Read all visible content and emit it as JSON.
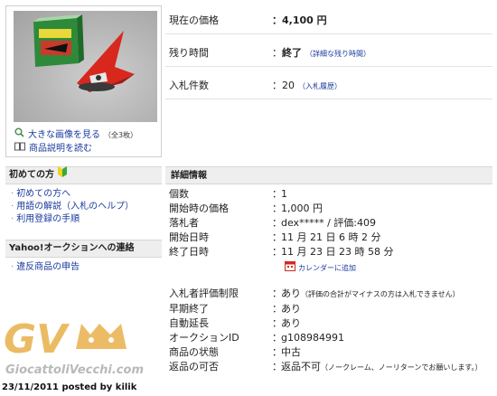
{
  "thumbnail": {
    "enlarge_link": "大きな画像を見る",
    "enlarge_count": "（全3枚）",
    "description_link": "商品説明を読む"
  },
  "beginner": {
    "title": "初めての方",
    "items": [
      "初めての方へ",
      "用語の解説（入札のヘルプ）",
      "利用登録の手順"
    ]
  },
  "contact": {
    "title": "Yahoo!オークションへの連絡",
    "items": [
      "違反商品の申告"
    ]
  },
  "summary": {
    "price_label": "現在の価格",
    "price_value": "4,100 円",
    "time_label": "残り時間",
    "time_value": "終了",
    "time_link": "（詳細な残り時間）",
    "bids_label": "入札件数",
    "bids_value": "20",
    "bids_link": "（入札履歴）"
  },
  "details": {
    "title": "詳細情報",
    "rows": [
      {
        "label": "個数",
        "value": "1"
      },
      {
        "label": "開始時の価格",
        "value": "1,000 円"
      },
      {
        "label": "落札者",
        "value": "dex***** / 評価:409"
      },
      {
        "label": "開始日時",
        "value": "11 月 21 日 6 時 2 分"
      },
      {
        "label": "終了日時",
        "value": "11 月 23 日 23 時 58 分"
      }
    ],
    "calendar_link": "カレンダーに追加",
    "rows2": [
      {
        "label": "入札者評価制限",
        "value": "あり",
        "note": "（評価の合計がマイナスの方は入札できません）"
      },
      {
        "label": "早期終了",
        "value": "あり"
      },
      {
        "label": "自動延長",
        "value": "あり"
      },
      {
        "label": "オークションID",
        "value": "g108984991"
      },
      {
        "label": "商品の状態",
        "value": "中古"
      },
      {
        "label": "返品の可否",
        "value": "返品不可",
        "note": "（ノークレーム、ノーリターンでお願いします。）"
      }
    ]
  },
  "watermark": {
    "logo": "GV",
    "site": "GiocattoliVecchi.com",
    "posted": "23/11/2011 posted by kilik"
  },
  "colors": {
    "link": "#1a3a9c",
    "header_bg": "#eeeeee",
    "toy_red": "#d8281e"
  }
}
